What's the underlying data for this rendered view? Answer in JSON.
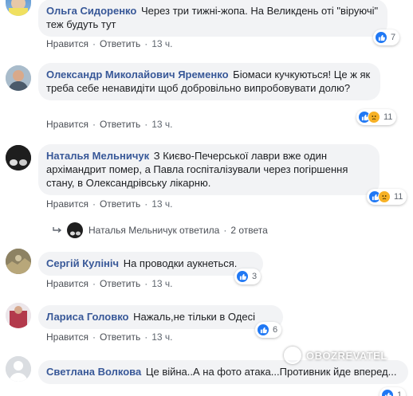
{
  "actions": {
    "like_label": "Нравится",
    "reply_label": "Ответить",
    "separator": "·"
  },
  "comments": [
    {
      "author": "Ольга Сидоренко",
      "text": "Через три тижні-жопа. На Великдень оті \"віруючі\" теж будуть тут",
      "time": "13 ч.",
      "reaction_count": "7",
      "reactions": [
        "like-icon"
      ]
    },
    {
      "author": "Олександр Миколайович Яременко",
      "text": "Біомаси кучкуються! Це ж як треба себе ненавидіти щоб добровільно випробовувати долю?",
      "time": "13 ч.",
      "reaction_count": "11",
      "reactions": [
        "like-icon",
        "sad-icon"
      ]
    },
    {
      "author": "Наталья Мельничук",
      "text": "З Києво-Печерської лаври вже один архімандрит помер, а Павла госпіталізували через погіршення стану, в Олександрівську лікарню.",
      "time": "13 ч.",
      "reaction_count": "11",
      "reactions": [
        "like-icon",
        "sad-icon"
      ]
    },
    {
      "author": "Сергій Кулініч",
      "text": "На проводки аукнеться.",
      "time": "13 ч.",
      "reaction_count": "3",
      "reactions": [
        "like-icon"
      ]
    },
    {
      "author": "Лариса Головко",
      "text": "Нажаль,не тільки в Одесі",
      "time": "13 ч.",
      "reaction_count": "6",
      "reactions": [
        "like-icon"
      ]
    },
    {
      "author": "Светлана Волкова",
      "text": "Це війна..А на фото атака...Противник йде вперед...",
      "reaction_count": "1",
      "reactions": [
        "like-icon"
      ]
    }
  ],
  "reply_summary": {
    "name": "Наталья Мельничук ответила",
    "count": "2 ответа"
  },
  "watermark": "OBOZREVATEL",
  "colors": {
    "author": "#385898",
    "bubble": "#f2f3f5",
    "like": "#2078f4",
    "sad": "#f7b125",
    "meta": "#606770"
  }
}
